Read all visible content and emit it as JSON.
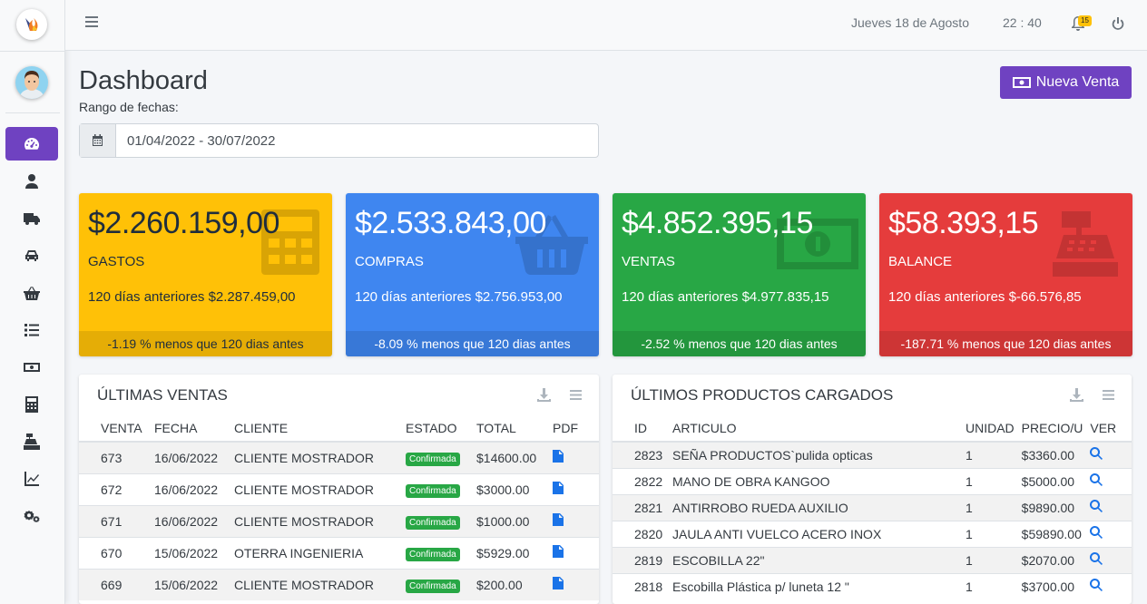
{
  "topbar": {
    "date": "Jueves 18 de Agosto",
    "time": "22 : 40",
    "notifications_count": "15"
  },
  "sidebar": {
    "items": [
      {
        "icon": "gauge-icon",
        "active": true
      },
      {
        "icon": "user-icon"
      },
      {
        "icon": "truck-icon"
      },
      {
        "icon": "car-icon"
      },
      {
        "icon": "basket-icon"
      },
      {
        "icon": "list-icon"
      },
      {
        "icon": "money-icon"
      },
      {
        "icon": "calculator-icon"
      },
      {
        "icon": "cash-register-icon"
      },
      {
        "icon": "chart-line-icon"
      },
      {
        "icon": "cogs-icon"
      }
    ]
  },
  "header": {
    "title": "Dashboard",
    "range_label": "Rango de fechas:",
    "date_range": "01/04/2022 - 30/07/2022",
    "new_sale_label": "Nueva Venta"
  },
  "stats": [
    {
      "amount": "$2.260.159,00",
      "name": "GASTOS",
      "prev": "120 días anteriores $2.287.459,00",
      "footer": "-1.19 % menos que 120 dias antes",
      "color": "#ffc107"
    },
    {
      "amount": "$2.533.843,00",
      "name": "COMPRAS",
      "prev": "120 días anteriores $2.756.953,00",
      "footer": "-8.09 % menos que 120 dias antes",
      "color": "#3f86f0"
    },
    {
      "amount": "$4.852.395,15",
      "name": "VENTAS",
      "prev": "120 días anteriores $4.977.835,15",
      "footer": "-2.52 % menos que 120 dias antes",
      "color": "#28a745"
    },
    {
      "amount": "$58.393,15",
      "name": "BALANCE",
      "prev": "120 días anteriores $-66.576,85",
      "footer": "-187.71 % menos que 120 dias antes",
      "color": "#e53c3c"
    }
  ],
  "ventas": {
    "title": "ÚLTIMAS VENTAS",
    "headers": [
      "VENTA",
      "FECHA",
      "CLIENTE",
      "ESTADO",
      "TOTAL",
      "PDF"
    ],
    "rows": [
      {
        "venta": "673",
        "fecha": "16/06/2022",
        "cliente": "CLIENTE MOSTRADOR",
        "estado": "Confirmada",
        "total": "$14600.00"
      },
      {
        "venta": "672",
        "fecha": "16/06/2022",
        "cliente": "CLIENTE MOSTRADOR",
        "estado": "Confirmada",
        "total": "$3000.00"
      },
      {
        "venta": "671",
        "fecha": "16/06/2022",
        "cliente": "CLIENTE MOSTRADOR",
        "estado": "Confirmada",
        "total": "$1000.00"
      },
      {
        "venta": "670",
        "fecha": "15/06/2022",
        "cliente": "OTERRA INGENIERIA",
        "estado": "Confirmada",
        "total": "$5929.00"
      },
      {
        "venta": "669",
        "fecha": "15/06/2022",
        "cliente": "CLIENTE MOSTRADOR",
        "estado": "Confirmada",
        "total": "$200.00"
      }
    ]
  },
  "productos": {
    "title": "ÚLTIMOS PRODUCTOS CARGADOS",
    "headers": [
      "ID",
      "ARTICULO",
      "UNIDAD",
      "PRECIO/U",
      "VER"
    ],
    "rows": [
      {
        "id": "2823",
        "articulo": "SEÑA PRODUCTOS`pulida opticas",
        "unidad": "1",
        "precio": "$3360.00"
      },
      {
        "id": "2822",
        "articulo": "MANO DE OBRA KANGOO",
        "unidad": "1",
        "precio": "$5000.00"
      },
      {
        "id": "2821",
        "articulo": "ANTIRROBO RUEDA AUXILIO",
        "unidad": "1",
        "precio": "$9890.00"
      },
      {
        "id": "2820",
        "articulo": "JAULA ANTI VUELCO ACERO INOX",
        "unidad": "1",
        "precio": "$59890.00"
      },
      {
        "id": "2819",
        "articulo": "ESCOBILLA 22\"",
        "unidad": "1",
        "precio": "$2070.00"
      },
      {
        "id": "2818",
        "articulo": "Escobilla Plástica p/ luneta 12 \"",
        "unidad": "1",
        "precio": "$3700.00"
      }
    ]
  }
}
